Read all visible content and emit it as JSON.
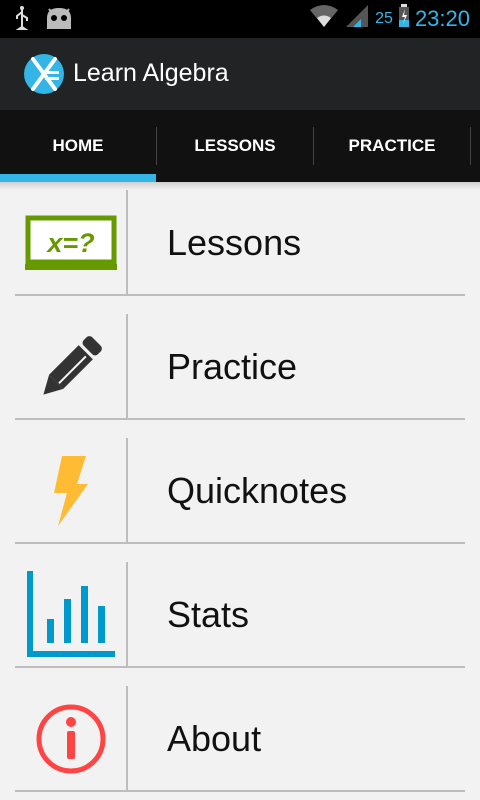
{
  "status_bar": {
    "icons": [
      "usb-icon",
      "android-icon",
      "wifi-icon",
      "signal-icon",
      "battery-icon"
    ],
    "battery_percent": "25",
    "time": "23:20",
    "accent_color": "#33b5e5"
  },
  "app": {
    "title": "Learn Algebra",
    "logo_icon": "x-equals-logo-icon"
  },
  "tabs": [
    {
      "label": "HOME",
      "selected": true
    },
    {
      "label": "LESSONS",
      "selected": false
    },
    {
      "label": "PRACTICE",
      "selected": false
    }
  ],
  "menu": {
    "items": [
      {
        "label": "Lessons",
        "icon": "chalkboard-icon",
        "icon_text": "x=?",
        "icon_color": "#669900"
      },
      {
        "label": "Practice",
        "icon": "pencil-icon",
        "icon_color": "#333333"
      },
      {
        "label": "Quicknotes",
        "icon": "lightning-icon",
        "icon_color": "#ffbb33"
      },
      {
        "label": "Stats",
        "icon": "bar-chart-icon",
        "icon_color": "#0099cc"
      },
      {
        "label": "About",
        "icon": "info-icon",
        "icon_color": "#ff4444"
      }
    ]
  }
}
